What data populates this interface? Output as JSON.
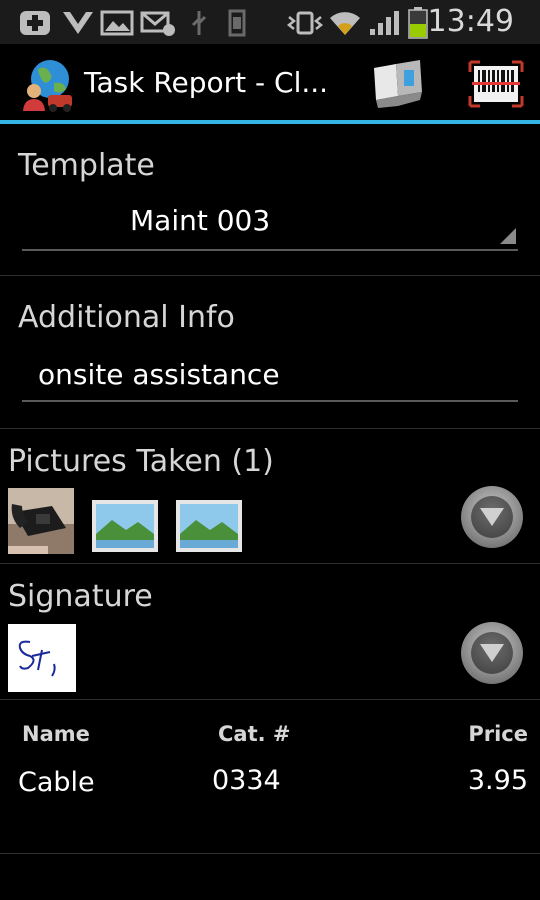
{
  "status_bar": {
    "time": "13:49",
    "icons": [
      "plus-badge-icon",
      "voicemail-icon",
      "gallery-icon",
      "email-icon",
      "usb-icon",
      "sd-card-icon",
      "vibrate-icon",
      "wifi-icon",
      "signal-icon",
      "battery-icon"
    ],
    "battery_color": "#99cc00"
  },
  "action_bar": {
    "title": "Task Report - Cl...",
    "accent": "#33b5e5",
    "icons": [
      "app-globe-icon",
      "barcode-device-icon",
      "barcode-scan-icon"
    ]
  },
  "template": {
    "label": "Template",
    "value": "Maint  003"
  },
  "additional_info": {
    "label": "Additional Info",
    "value": "onsite assistance"
  },
  "pictures": {
    "label": "Pictures Taken (1)",
    "thumbnails": [
      "phone-photo",
      "image-placeholder",
      "image-placeholder"
    ]
  },
  "signature": {
    "label": "Signature",
    "image": "signature-scribble"
  },
  "items_table": {
    "columns": [
      "Name",
      "Cat. #",
      "Price"
    ],
    "rows": [
      [
        "Cable",
        "0334",
        "3.95"
      ]
    ]
  }
}
